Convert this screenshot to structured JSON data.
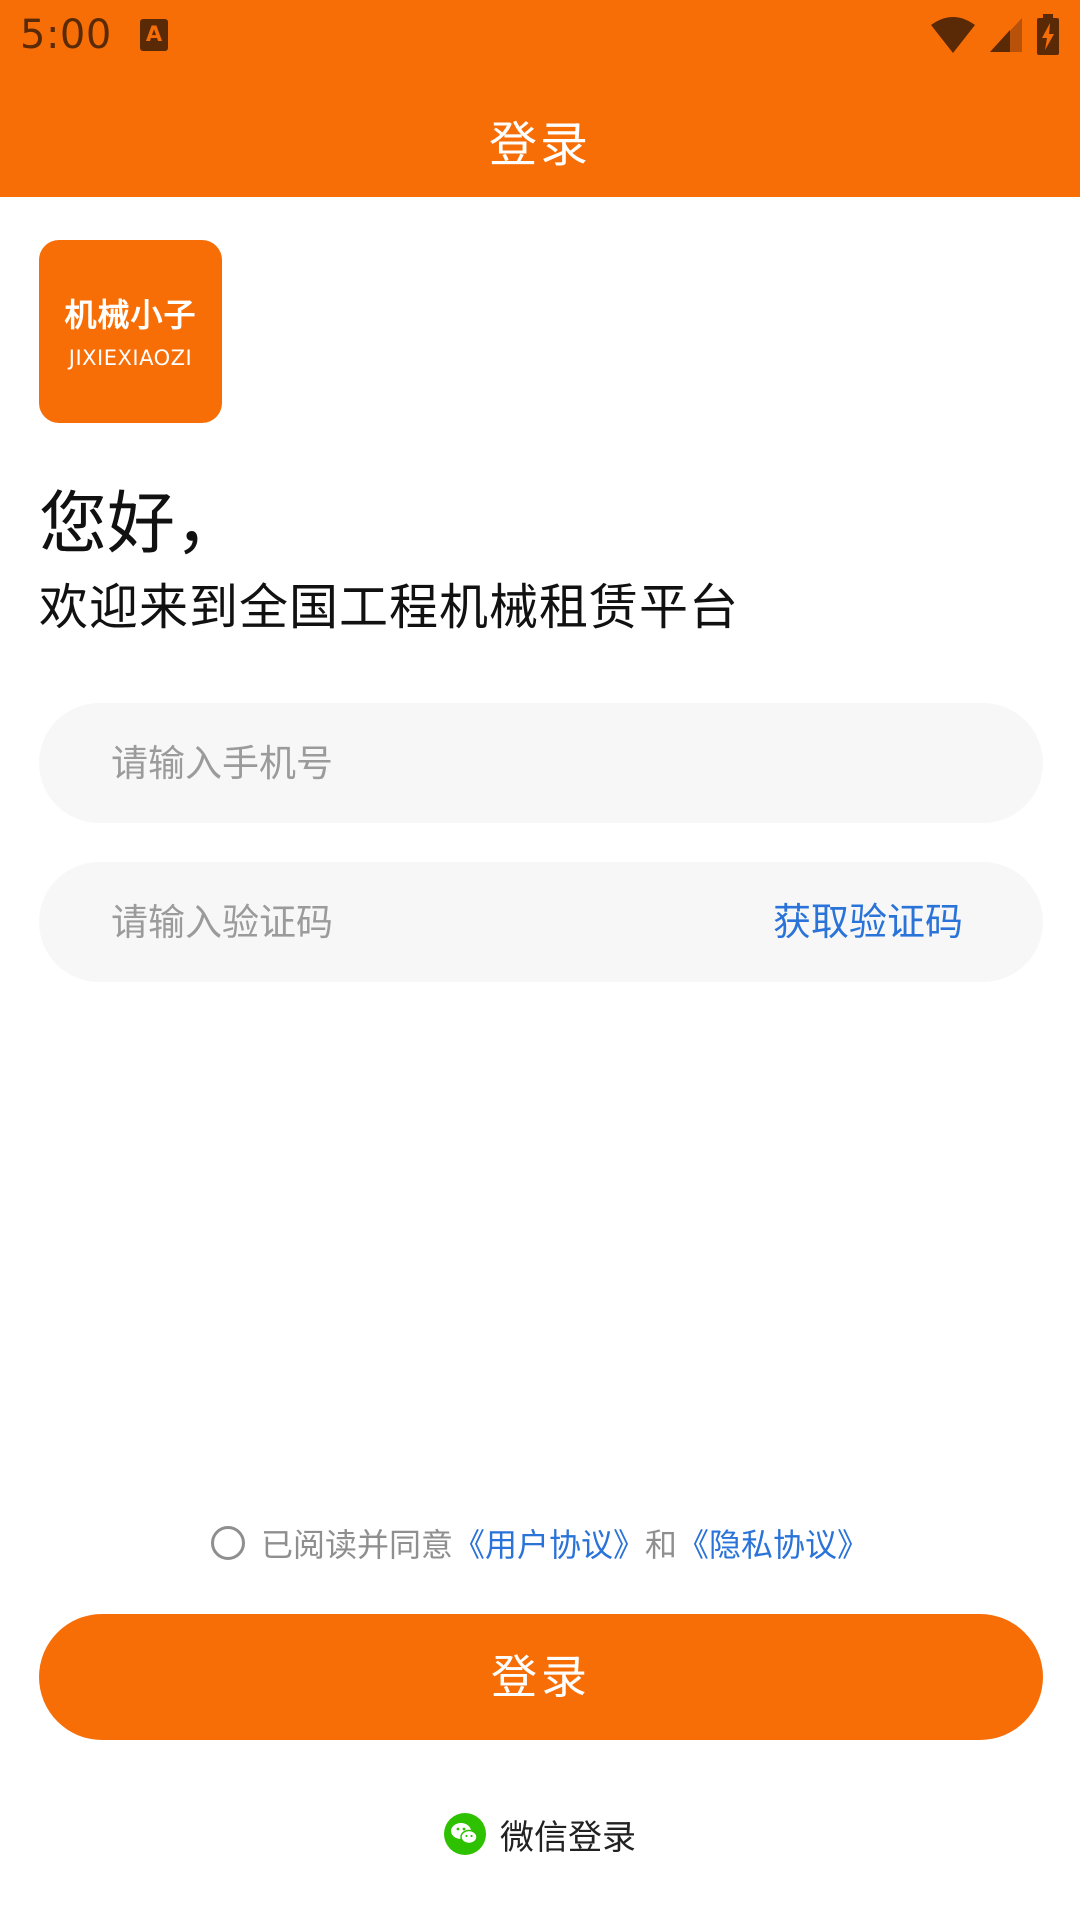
{
  "status_bar": {
    "time": "5:00",
    "app_icon_glyph": "A",
    "icons": [
      "wifi-icon",
      "cell-signal-icon",
      "battery-charging-icon"
    ]
  },
  "header": {
    "title": "登录",
    "color": "#f76e07"
  },
  "logo": {
    "cn": "机械小子",
    "en": "JIXIEXIAOZI"
  },
  "greeting": {
    "hello": "您好，",
    "welcome": "欢迎来到全国工程机械租赁平台"
  },
  "form": {
    "phone": {
      "value": "",
      "placeholder": "请输入手机号"
    },
    "code": {
      "value": "",
      "placeholder": "请输入验证码",
      "get_code_label": "获取验证码"
    }
  },
  "agreement": {
    "checked": false,
    "prefix": "已阅读并同意",
    "user_agreement": "《用户协议》",
    "and": "和",
    "privacy_policy": "《隐私协议》"
  },
  "login_button": {
    "label": "登录"
  },
  "wechat": {
    "label": "微信登录",
    "icon": "wechat-icon"
  },
  "colors": {
    "accent": "#f76e07",
    "link": "#2a73d8",
    "input_bg": "#f7f7f7",
    "wechat_green": "#2dc100"
  }
}
